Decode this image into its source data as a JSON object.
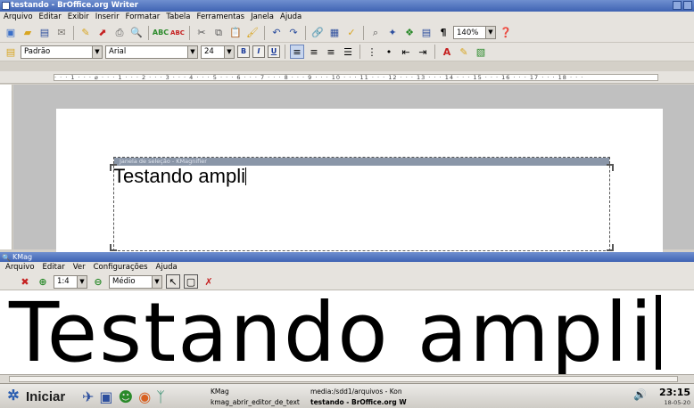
{
  "writer": {
    "title": "testando - BrOffice.org Writer",
    "menu": [
      "Arquivo",
      "Editar",
      "Exibir",
      "Inserir",
      "Formatar",
      "Tabela",
      "Ferramentas",
      "Janela",
      "Ajuda"
    ],
    "style": "Padrão",
    "font": "Arial",
    "size": "24",
    "zoom": "140%",
    "format_buttons": [
      "B",
      "I",
      "U"
    ],
    "ruler_text": "· · · 1 · · · ⌀ · · · 1 · · · 2 · · · 3 · · · 4 · · · 5 · · · 6 · · · 7 · · · 8 · · · 9 · · · 10 · · · 11 · · · 12 · · · 13 · · · 14 · · · 15 · · · 16 · · · 17 · · · 18 · · ·",
    "doc_text": "Testando ampli"
  },
  "kmag_selection": {
    "label": "Janela de seleção - KMagnifier"
  },
  "kmag": {
    "title": "KMag",
    "menu": [
      "Arquivo",
      "Editar",
      "Ver",
      "Configurações",
      "Ajuda"
    ],
    "zoom": "1:4",
    "rotation": "Médio",
    "magnified_text": "Testando ampli"
  },
  "taskbar": {
    "start_label": "Iniciar",
    "tasks": [
      "KMag",
      "kmag_abrir_editor_de_texto",
      "media:/sdd1/arquivos - Kon",
      "testando - BrOffice.org W"
    ],
    "clock": "23:15",
    "date": "18-05-20"
  }
}
